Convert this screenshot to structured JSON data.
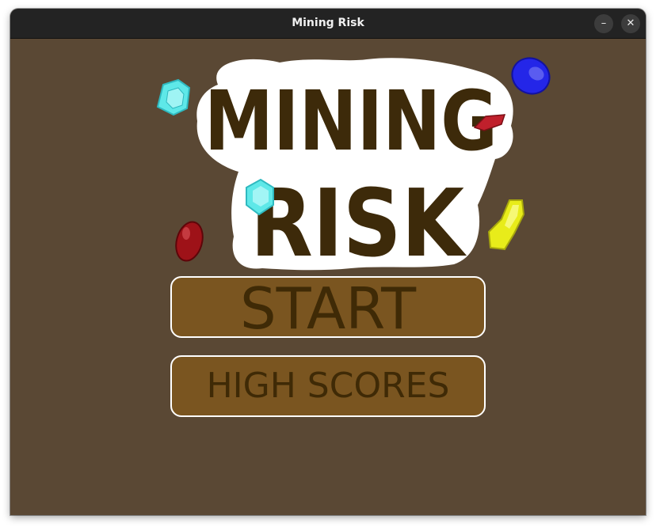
{
  "window": {
    "title": "Mining Risk",
    "minimize_glyph": "–",
    "close_glyph": "✕"
  },
  "logo": {
    "line1": "MINING",
    "line2": "RISK",
    "gems": [
      "cyan-gem",
      "blue-gem",
      "red-gem",
      "yellow-gem"
    ]
  },
  "menu": {
    "start_label": "START",
    "high_scores_label": "HIGH SCORES"
  },
  "colors": {
    "background": "#5a4834",
    "button_fill": "#7a5520",
    "button_text": "#3f2a06",
    "logo_text": "#3d2a0a"
  }
}
